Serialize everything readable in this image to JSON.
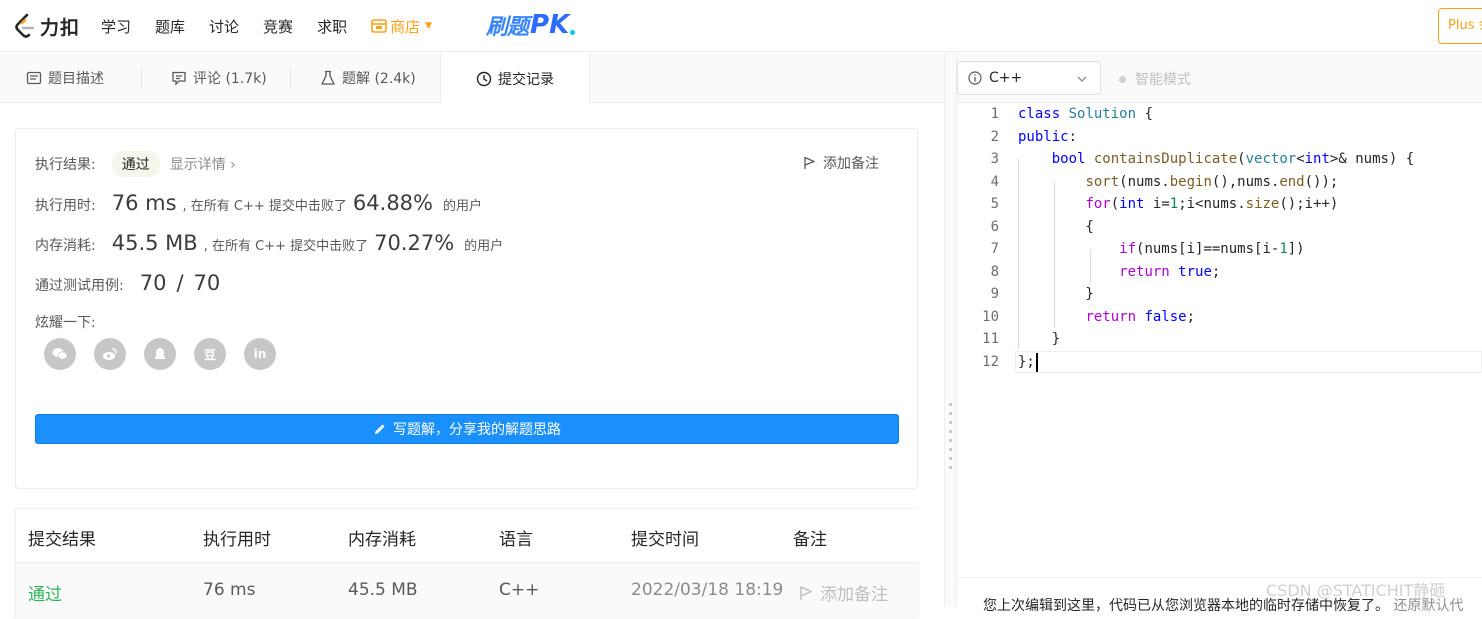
{
  "brand": {
    "name": "力扣"
  },
  "nav": {
    "items": [
      "学习",
      "题库",
      "讨论",
      "竞赛",
      "求职"
    ],
    "shop": "商店",
    "pk_cn": "刷题",
    "pk_en": "PK",
    "plus": "Plus 会"
  },
  "tabs": [
    {
      "label": "题目描述"
    },
    {
      "label": "评论 (1.7k)"
    },
    {
      "label": "题解 (2.4k)"
    },
    {
      "label": "提交记录"
    }
  ],
  "result": {
    "status_label": "执行结果:",
    "status": "通过",
    "show_detail": "显示详情 ›",
    "add_note": "添加备注",
    "runtime_label": "执行用时:",
    "runtime": "76 ms",
    "runtime_mid": ", 在所有 C++ 提交中击败了",
    "runtime_pct": "64.88%",
    "runtime_tail": "的用户",
    "memory_label": "内存消耗:",
    "memory": "45.5 MB",
    "memory_mid": ", 在所有 C++ 提交中击败了",
    "memory_pct": "70.27%",
    "memory_tail": "的用户",
    "tests_label": "通过测试用例:",
    "tests_passed": "70",
    "tests_sep": "/",
    "tests_total": "70",
    "share_label": "炫耀一下:",
    "share_icons": [
      "wechat-icon",
      "weibo-icon",
      "qq-icon",
      "douban-icon",
      "linkedin-icon"
    ],
    "douban": "豆",
    "linkedin": "in",
    "write_btn": "写题解，分享我的解题思路"
  },
  "table": {
    "headers": [
      "提交结果",
      "执行用时",
      "内存消耗",
      "语言",
      "提交时间",
      "备注"
    ],
    "rows": [
      [
        "通过",
        "76 ms",
        "45.5 MB",
        "C++",
        "2022/03/18 18:19",
        "添加备注"
      ]
    ]
  },
  "editor": {
    "language": "C++",
    "smart_mode": "智能模式",
    "lines": [
      "1",
      "2",
      "3",
      "4",
      "5",
      "6",
      "7",
      "8",
      "9",
      "10",
      "11",
      "12"
    ],
    "restore_text": "您上次编辑到这里，代码已从您浏览器本地的临时存储中恢复了。",
    "restore_link": "还原默认代",
    "watermark": "CSDN @STATICHIT静砸"
  },
  "colors": {
    "accent": "#ffa116",
    "primary": "#1a90ff",
    "pass": "#2db55d"
  }
}
